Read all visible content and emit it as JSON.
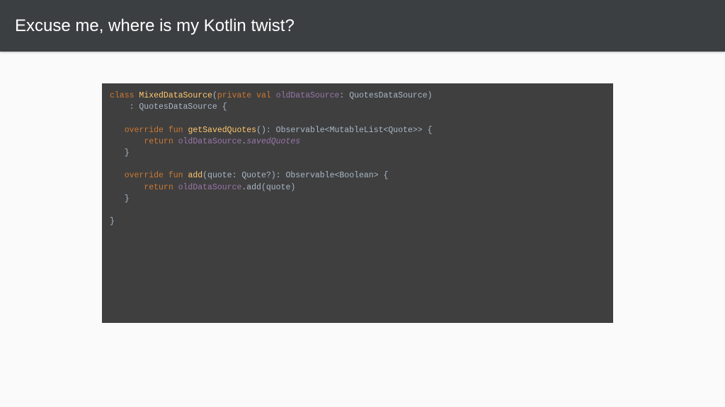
{
  "slide": {
    "title": "Excuse me, where is my Kotlin twist?"
  },
  "colors": {
    "header_bg": "#3c3f41",
    "page_bg": "#fafafa",
    "code_bg": "#3f3f3f",
    "code_text": "#a9b7c6",
    "code_keyword": "#cc7832",
    "code_function": "#ffc66d",
    "code_property": "#9876aa"
  },
  "code": {
    "language": "Kotlin",
    "lines": [
      [
        {
          "text": "class ",
          "style": "keyword"
        },
        {
          "text": "MixedDataSource",
          "style": "function"
        },
        {
          "text": "(",
          "style": "plain"
        },
        {
          "text": "private val ",
          "style": "keyword"
        },
        {
          "text": "oldDataSource",
          "style": "property"
        },
        {
          "text": ": QuotesDataSource)",
          "style": "plain"
        }
      ],
      [
        {
          "text": "    : QuotesDataSource {",
          "style": "plain"
        }
      ],
      [],
      [
        {
          "text": "   ",
          "style": "plain"
        },
        {
          "text": "override fun ",
          "style": "keyword"
        },
        {
          "text": "getSavedQuotes",
          "style": "function"
        },
        {
          "text": "(): Observable<MutableList<Quote>> {",
          "style": "plain"
        }
      ],
      [
        {
          "text": "       ",
          "style": "plain"
        },
        {
          "text": "return ",
          "style": "keyword"
        },
        {
          "text": "oldDataSource",
          "style": "property"
        },
        {
          "text": ".",
          "style": "plain"
        },
        {
          "text": "savedQuotes",
          "style": "italic"
        }
      ],
      [
        {
          "text": "   }",
          "style": "plain"
        }
      ],
      [],
      [
        {
          "text": "   ",
          "style": "plain"
        },
        {
          "text": "override fun ",
          "style": "keyword"
        },
        {
          "text": "add",
          "style": "function"
        },
        {
          "text": "(quote: Quote?): Observable<Boolean> {",
          "style": "plain"
        }
      ],
      [
        {
          "text": "       ",
          "style": "plain"
        },
        {
          "text": "return ",
          "style": "keyword"
        },
        {
          "text": "oldDataSource",
          "style": "property"
        },
        {
          "text": ".add(quote)",
          "style": "plain"
        }
      ],
      [
        {
          "text": "   }",
          "style": "plain"
        }
      ],
      [],
      [
        {
          "text": "}",
          "style": "plain"
        }
      ]
    ]
  }
}
